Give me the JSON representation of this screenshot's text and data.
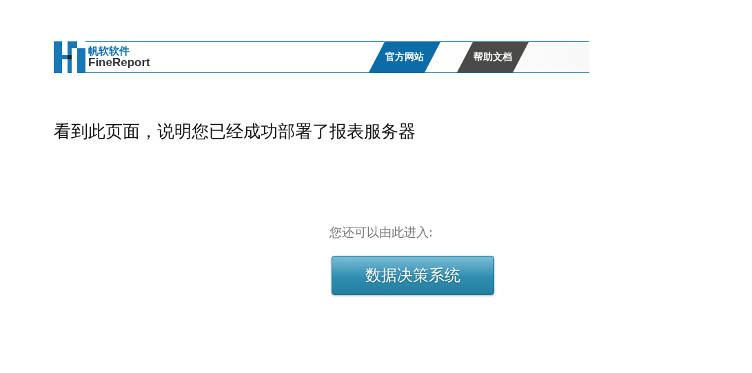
{
  "header": {
    "logo": {
      "brand_cn": "帆软软件",
      "brand_en": "FineReport"
    },
    "links": [
      {
        "label": "官方网站",
        "kind": "primary"
      },
      {
        "label": "帮助文档",
        "kind": "secondary"
      }
    ]
  },
  "message": "看到此页面，说明您已经成功部署了报表服务器",
  "prompt": "您还可以由此进入:",
  "enter_button": "数据决策系统"
}
